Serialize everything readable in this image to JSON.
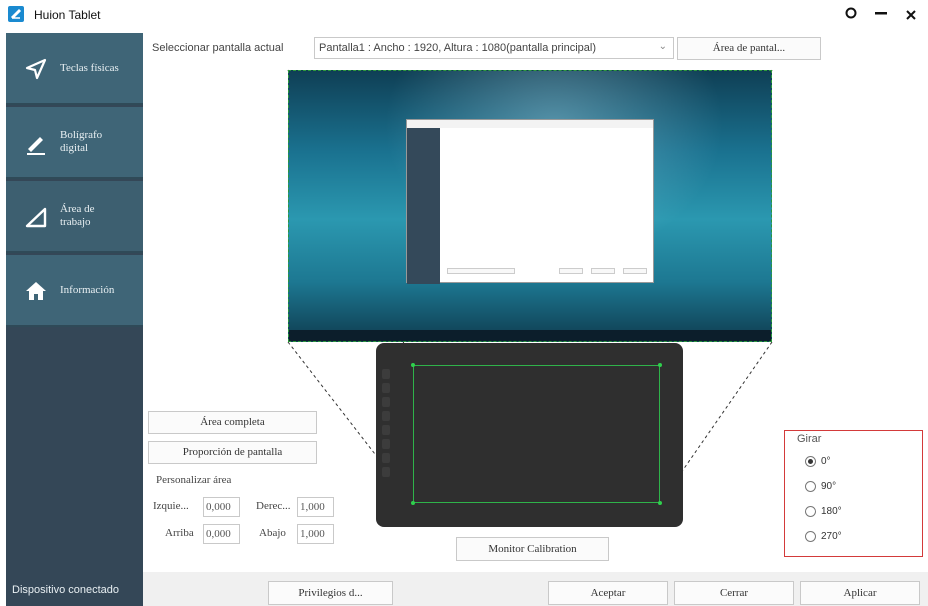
{
  "window": {
    "title": "Huion Tablet"
  },
  "sidebar": {
    "items": [
      {
        "label_line1": "Teclas físicas",
        "label_line2": "",
        "icon": "send-arrow-icon"
      },
      {
        "label_line1": "Bolígrafo",
        "label_line2": "digital",
        "icon": "pen-icon"
      },
      {
        "label_line1": "Área de",
        "label_line2": "trabajo",
        "icon": "triangle-area-icon"
      },
      {
        "label_line1": "Información",
        "label_line2": "",
        "icon": "home-icon"
      }
    ],
    "connected_status": "Dispositivo conectado"
  },
  "display": {
    "select_label": "Seleccionar pantalla actual",
    "selected_value": "Pantalla1 : Ancho : 1920, Altura : 1080(pantalla principal)",
    "screen_area_button": "Área de pantal..."
  },
  "area": {
    "full_area_button": "Área completa",
    "screen_ratio_button": "Proporción de pantalla",
    "customize_label": "Personalizar área",
    "left_label": "Izquie...",
    "left_value": "0,000",
    "right_label": "Derec...",
    "right_value": "1,000",
    "top_label": "Arriba",
    "top_value": "0,000",
    "bottom_label": "Abajo",
    "bottom_value": "1,000"
  },
  "monitor_calibration_button": "Monitor Calibration",
  "rotation": {
    "title": "Girar",
    "options": [
      "0°",
      "90°",
      "180°",
      "270°"
    ],
    "selected": "0°"
  },
  "footer": {
    "privileges_button": "Privilegios d...",
    "accept_button": "Aceptar",
    "close_button": "Cerrar",
    "apply_button": "Aplicar"
  },
  "colors": {
    "sidebar_bg": "#344757",
    "sidebar_item": "#3f6577",
    "active_area_border": "#2fb34a",
    "rotation_border": "#d33a3a"
  }
}
